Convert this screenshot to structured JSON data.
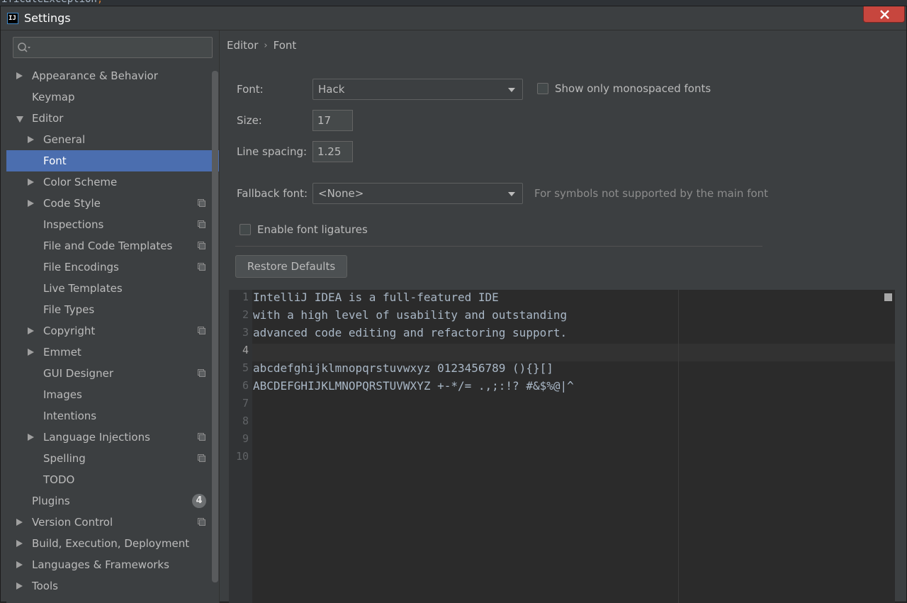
{
  "window": {
    "title": "Settings",
    "close_icon": "close-icon"
  },
  "background_snippet": {
    "text": "ificateException",
    "punct": ";"
  },
  "sidebar": {
    "search_placeholder": "",
    "items": [
      {
        "label": "Appearance & Behavior",
        "level": 0,
        "arrow": "right",
        "proj": false
      },
      {
        "label": "Keymap",
        "level": 0,
        "arrow": "none",
        "proj": false
      },
      {
        "label": "Editor",
        "level": 0,
        "arrow": "down",
        "proj": false
      },
      {
        "label": "General",
        "level": 1,
        "arrow": "right",
        "proj": false
      },
      {
        "label": "Font",
        "level": 1,
        "arrow": "none",
        "proj": false,
        "selected": true
      },
      {
        "label": "Color Scheme",
        "level": 1,
        "arrow": "right",
        "proj": false
      },
      {
        "label": "Code Style",
        "level": 1,
        "arrow": "right",
        "proj": true
      },
      {
        "label": "Inspections",
        "level": 1,
        "arrow": "none",
        "proj": true
      },
      {
        "label": "File and Code Templates",
        "level": 1,
        "arrow": "none",
        "proj": true
      },
      {
        "label": "File Encodings",
        "level": 1,
        "arrow": "none",
        "proj": true
      },
      {
        "label": "Live Templates",
        "level": 1,
        "arrow": "none",
        "proj": false
      },
      {
        "label": "File Types",
        "level": 1,
        "arrow": "none",
        "proj": false
      },
      {
        "label": "Copyright",
        "level": 1,
        "arrow": "right",
        "proj": true
      },
      {
        "label": "Emmet",
        "level": 1,
        "arrow": "right",
        "proj": false
      },
      {
        "label": "GUI Designer",
        "level": 1,
        "arrow": "none",
        "proj": true
      },
      {
        "label": "Images",
        "level": 1,
        "arrow": "none",
        "proj": false
      },
      {
        "label": "Intentions",
        "level": 1,
        "arrow": "none",
        "proj": false
      },
      {
        "label": "Language Injections",
        "level": 1,
        "arrow": "right",
        "proj": true
      },
      {
        "label": "Spelling",
        "level": 1,
        "arrow": "none",
        "proj": true
      },
      {
        "label": "TODO",
        "level": 1,
        "arrow": "none",
        "proj": false
      },
      {
        "label": "Plugins",
        "level": 0,
        "arrow": "none",
        "proj": false,
        "badge": "4"
      },
      {
        "label": "Version Control",
        "level": 0,
        "arrow": "right",
        "proj": true
      },
      {
        "label": "Build, Execution, Deployment",
        "level": 0,
        "arrow": "right",
        "proj": false
      },
      {
        "label": "Languages & Frameworks",
        "level": 0,
        "arrow": "right",
        "proj": false
      },
      {
        "label": "Tools",
        "level": 0,
        "arrow": "right",
        "proj": false
      }
    ]
  },
  "breadcrumb": {
    "parent": "Editor",
    "separator": "›",
    "current": "Font"
  },
  "form": {
    "font_label": "Font:",
    "font_value": "Hack",
    "mono_label": "Show only monospaced fonts",
    "mono_checked": false,
    "size_label": "Size:",
    "size_value": "17",
    "spacing_label": "Line spacing:",
    "spacing_value": "1.25",
    "fallback_label": "Fallback font:",
    "fallback_value": "<None>",
    "fallback_hint": "For symbols not supported by the main font",
    "ligatures_label": "Enable font ligatures",
    "ligatures_checked": false,
    "restore_label": "Restore Defaults"
  },
  "preview": {
    "line_numbers": [
      "1",
      "2",
      "3",
      "4",
      "5",
      "6",
      "7",
      "8",
      "9",
      "10"
    ],
    "lines": [
      "IntelliJ IDEA is a full-featured IDE",
      "with a high level of usability and outstanding",
      "advanced code editing and refactoring support.",
      "",
      "abcdefghijklmnopqrstuvwxyz 0123456789 (){}[]",
      "ABCDEFGHIJKLMNOPQRSTUVWXYZ +-*/= .,;:!? #&$%@|^"
    ],
    "current_line": 4
  }
}
